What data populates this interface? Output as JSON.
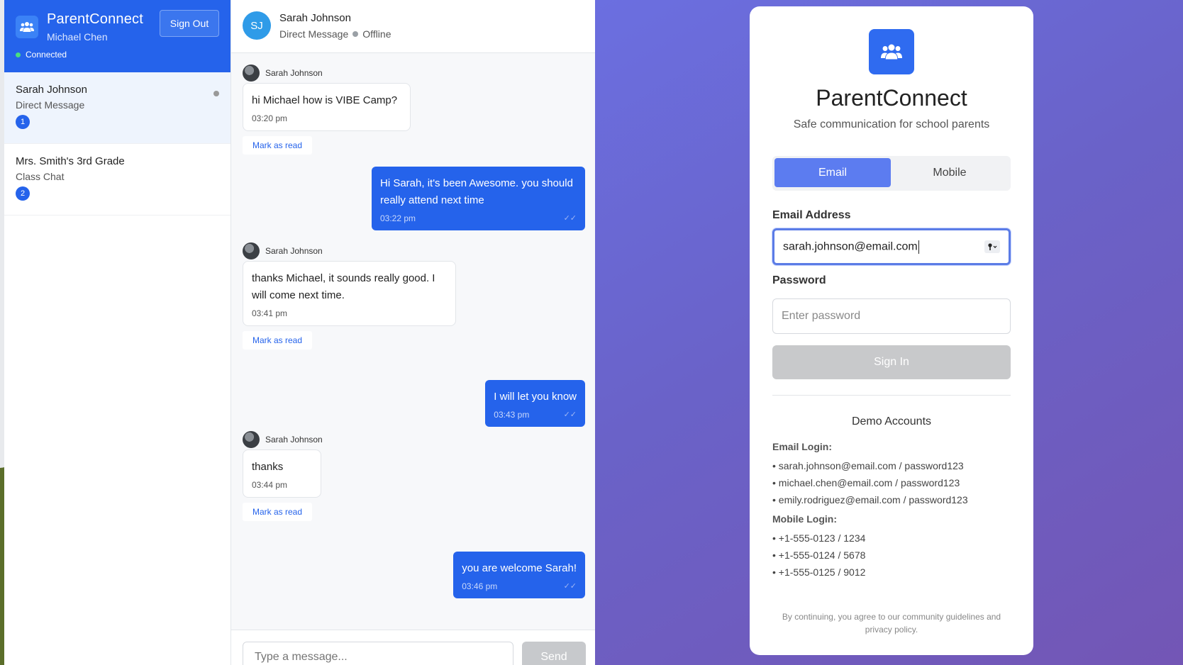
{
  "app": {
    "title": "ParentConnect",
    "user": "Michael Chen",
    "sign_out": "Sign Out",
    "status": "Connected"
  },
  "conversations": [
    {
      "name": "Sarah Johnson",
      "type": "Direct Message",
      "badge": "1"
    },
    {
      "name": "Mrs. Smith's 3rd Grade",
      "type": "Class Chat",
      "badge": "2"
    }
  ],
  "chat": {
    "avatar_initials": "SJ",
    "name": "Sarah Johnson",
    "type": "Direct Message",
    "presence": "Offline",
    "mark_read": "Mark as read",
    "ticks": "✓✓",
    "messages": [
      {
        "sender": "Sarah Johnson",
        "text": "hi Michael how is VIBE Camp?",
        "time": "03:20 pm"
      },
      {
        "text": "Hi Sarah, it's been Awesome. you should really attend next time",
        "time": "03:22 pm"
      },
      {
        "sender": "Sarah Johnson",
        "text": "thanks Michael, it sounds really good. I will come next time.",
        "time": "03:41 pm"
      },
      {
        "text": "I will let you know",
        "time": "03:43 pm"
      },
      {
        "sender": "Sarah Johnson",
        "text": "thanks",
        "time": "03:44 pm"
      },
      {
        "text": "you are welcome Sarah!",
        "time": "03:46 pm"
      }
    ],
    "input_placeholder": "Type a message...",
    "send": "Send"
  },
  "login": {
    "title": "ParentConnect",
    "subtitle": "Safe communication for school parents",
    "tab_email": "Email",
    "tab_mobile": "Mobile",
    "email_label": "Email Address",
    "email_value": "sarah.johnson@email.com",
    "password_label": "Password",
    "password_placeholder": "Enter password",
    "sign_in": "Sign In",
    "demo_title": "Demo Accounts",
    "email_login_heading": "Email Login:",
    "email_accounts": [
      "• sarah.johnson@email.com / password123",
      "• michael.chen@email.com / password123",
      "• emily.rodriguez@email.com / password123"
    ],
    "mobile_login_heading": "Mobile Login:",
    "mobile_accounts": [
      "• +1-555-0123 / 1234",
      "• +1-555-0124 / 5678",
      "• +1-555-0125 / 9012"
    ],
    "legal": "By continuing, you agree to our community guidelines and privacy policy."
  },
  "colors": {
    "brand_blue": "#2563eb",
    "login_gradient_start": "#6b6fe0",
    "login_gradient_end": "#7356b5",
    "connected_green": "#4ade80"
  },
  "icons": [
    "users-icon",
    "key-icon",
    "check-double-icon"
  ]
}
